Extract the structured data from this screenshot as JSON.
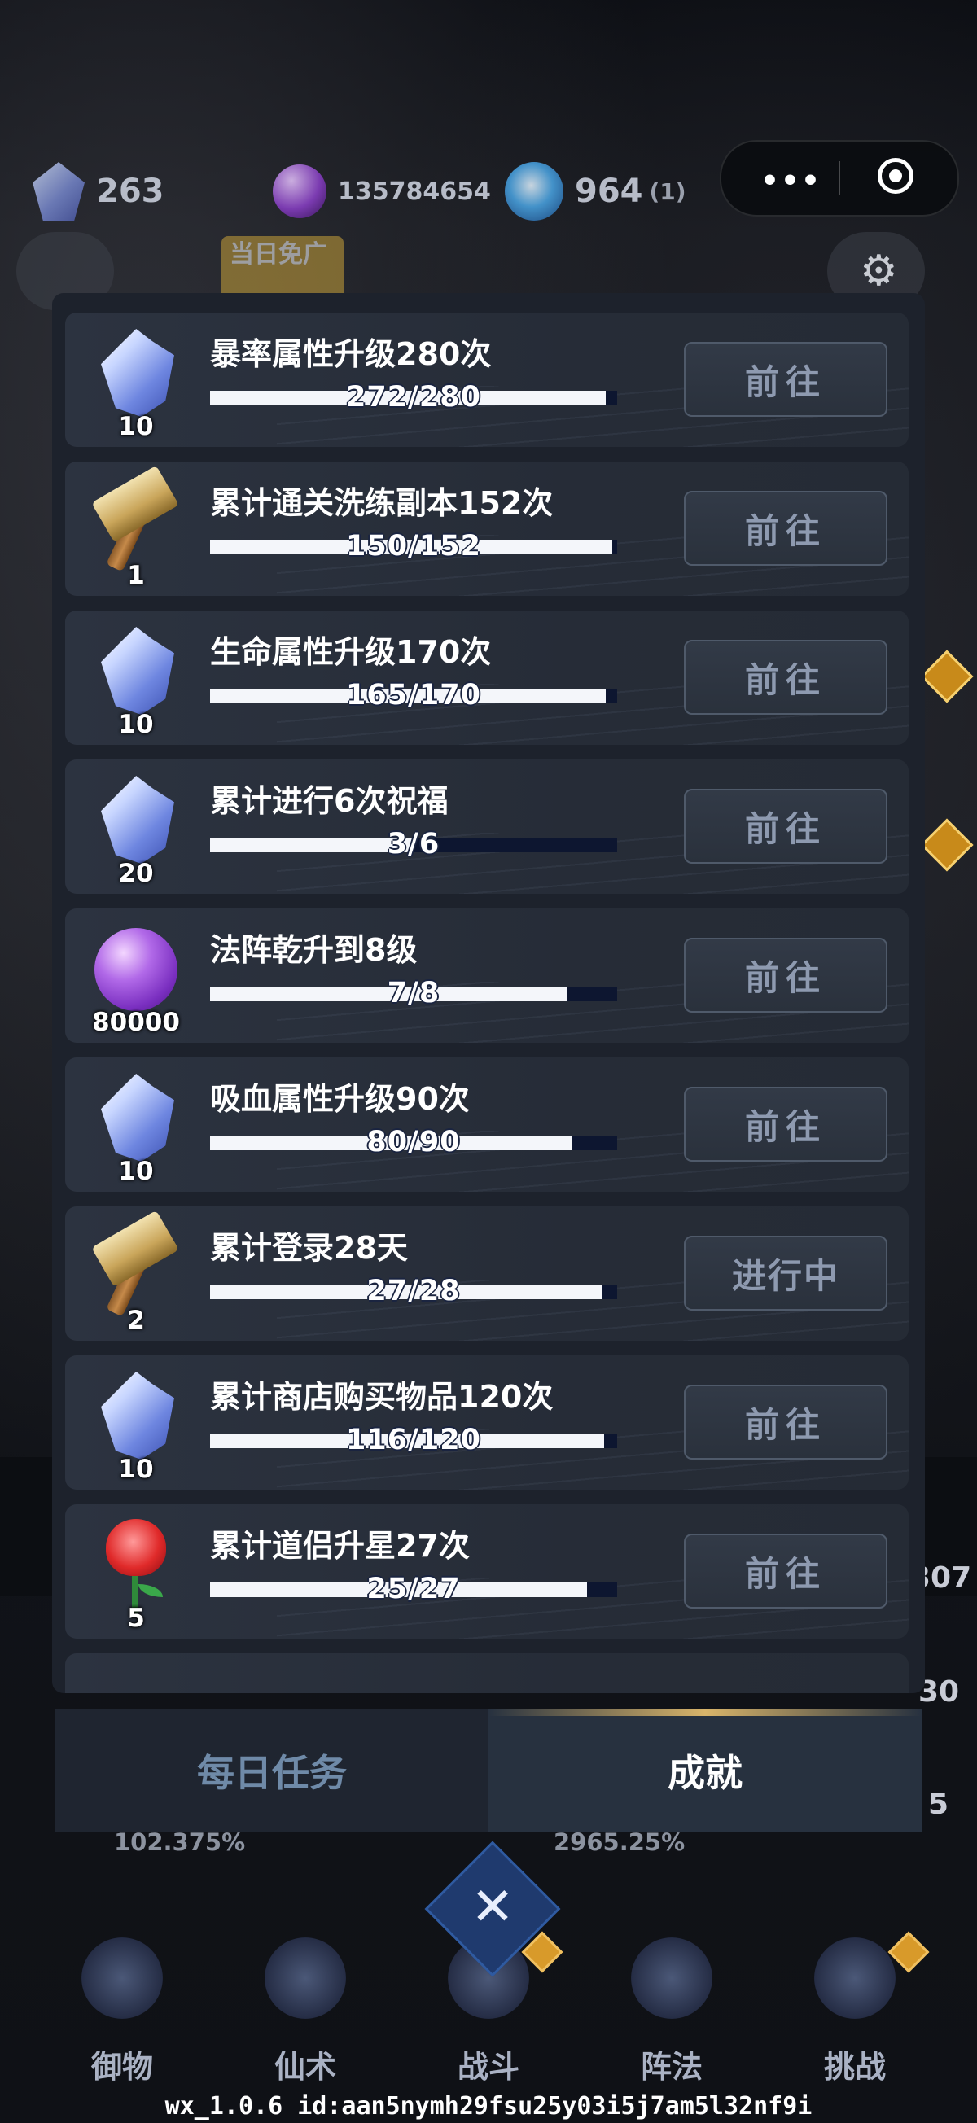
{
  "resources": {
    "crystal_count": "263",
    "orb_count": "135784654",
    "gem_count": "964",
    "gem_extra": "(1)"
  },
  "free_tag": "当日免广",
  "tasks": [
    {
      "title": "暴率属性升级280次",
      "progress_text": "272/280",
      "progress": 0.971,
      "reward_icon": "crystal-icon",
      "reward_count": "10",
      "action": "前往"
    },
    {
      "title": "累计通关洗练副本152次",
      "progress_text": "150/152",
      "progress": 0.987,
      "reward_icon": "hammer-icon",
      "reward_count": "1",
      "action": "前往"
    },
    {
      "title": "生命属性升级170次",
      "progress_text": "165/170",
      "progress": 0.971,
      "reward_icon": "crystal-icon",
      "reward_count": "10",
      "action": "前往"
    },
    {
      "title": "累计进行6次祝福",
      "progress_text": "3/6",
      "progress": 0.5,
      "reward_icon": "crystal-icon",
      "reward_count": "20",
      "action": "前往"
    },
    {
      "title": "法阵乾升到8级",
      "progress_text": "7/8",
      "progress": 0.875,
      "reward_icon": "orb-icon",
      "reward_count": "80000",
      "action": "前往"
    },
    {
      "title": "吸血属性升级90次",
      "progress_text": "80/90",
      "progress": 0.889,
      "reward_icon": "crystal-icon",
      "reward_count": "10",
      "action": "前往"
    },
    {
      "title": "累计登录28天",
      "progress_text": "27/28",
      "progress": 0.964,
      "reward_icon": "hammer-icon",
      "reward_count": "2",
      "action": "进行中"
    },
    {
      "title": "累计商店购买物品120次",
      "progress_text": "116/120",
      "progress": 0.967,
      "reward_icon": "crystal-icon",
      "reward_count": "10",
      "action": "前往"
    },
    {
      "title": "累计道侣升星27次",
      "progress_text": "25/27",
      "progress": 0.926,
      "reward_icon": "rose-icon",
      "reward_count": "5",
      "action": "前往"
    }
  ],
  "tabs": {
    "daily": "每日任务",
    "achievement": "成就"
  },
  "stats": {
    "left": "102.375%",
    "middle": "2965.25%"
  },
  "side_numbers": {
    "a": "307",
    "b": "30",
    "c": "5"
  },
  "nav": [
    "御物",
    "仙术",
    "战斗",
    "阵法",
    "挑战"
  ],
  "footer": "wx_1.0.6 id:aan5nymh29fsu25y03i5j7am5l32nf9i",
  "colors": {
    "panel": "#1d222c",
    "progress_track": "#0d1630",
    "progress_fill": "#f4f6fa",
    "button_text": "#8e9ab0",
    "tab_active_text": "#ffffff",
    "tab_inactive_text": "#6f8aa8"
  }
}
